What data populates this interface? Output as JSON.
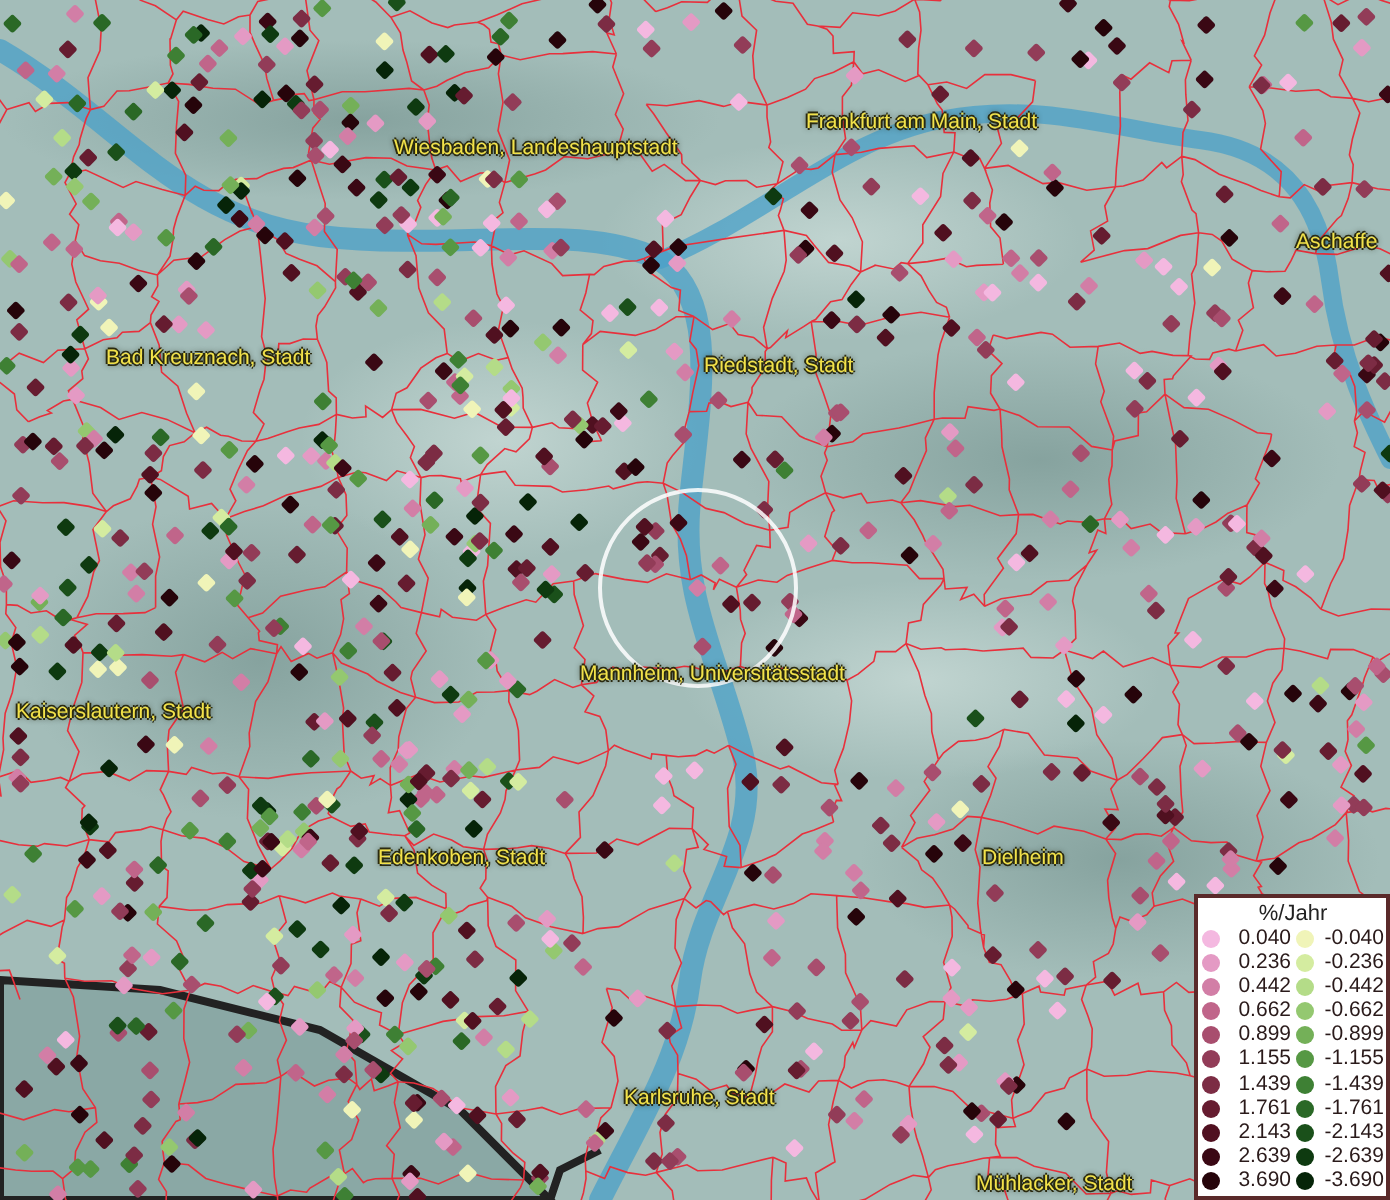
{
  "map_labels": [
    {
      "text": "Frankfurt am Main, Stadt"
    },
    {
      "text": "Wiesbaden, Landeshauptstadt"
    },
    {
      "text": "Aschaffe"
    },
    {
      "text": "Bad Kreuznach, Stadt"
    },
    {
      "text": "Riedstadt, Stadt"
    },
    {
      "text": "Mannheim, Universitätsstadt"
    },
    {
      "text": "Kaiserslautern, Stadt"
    },
    {
      "text": "Edenkoben, Stadt"
    },
    {
      "text": "Dielheim"
    },
    {
      "text": "Karlsruhe, Stadt"
    },
    {
      "text": "Mühlacker, Stadt"
    }
  ],
  "legend": {
    "title": "%/Jahr",
    "positive": [
      {
        "value": "0.040",
        "color": "#f4b8e0"
      },
      {
        "value": "0.236",
        "color": "#e49ac4"
      },
      {
        "value": "0.442",
        "color": "#d27ea6"
      },
      {
        "value": "0.662",
        "color": "#c0658a"
      },
      {
        "value": "0.899",
        "color": "#a84e6e"
      },
      {
        "value": "1.155",
        "color": "#923c58"
      },
      {
        "value": "1.439",
        "color": "#7c2c44"
      },
      {
        "value": "1.761",
        "color": "#661c30"
      },
      {
        "value": "2.143",
        "color": "#501020"
      },
      {
        "value": "2.639",
        "color": "#3a0814"
      },
      {
        "value": "3.690",
        "color": "#26040a"
      }
    ],
    "negative": [
      {
        "value": "-0.040",
        "color": "#f0f4b8"
      },
      {
        "value": "-0.236",
        "color": "#d4eca0"
      },
      {
        "value": "-0.442",
        "color": "#b4dc88"
      },
      {
        "value": "-0.662",
        "color": "#94c870"
      },
      {
        "value": "-0.899",
        "color": "#74b058"
      },
      {
        "value": "-1.155",
        "color": "#569844"
      },
      {
        "value": "-1.439",
        "color": "#3e8034"
      },
      {
        "value": "-1.761",
        "color": "#2a6826"
      },
      {
        "value": "-2.143",
        "color": "#1a501a"
      },
      {
        "value": "-2.639",
        "color": "#0e3a10"
      },
      {
        "value": "-3.690",
        "color": "#062408"
      }
    ]
  }
}
